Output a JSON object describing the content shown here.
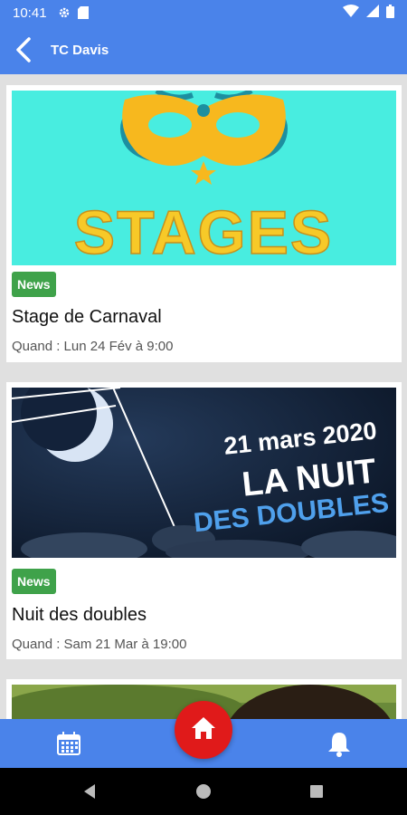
{
  "status_bar": {
    "time": "10:41",
    "icons": [
      "gear-icon",
      "sim-icon",
      "wifi-icon",
      "signal-icon",
      "battery-icon"
    ]
  },
  "app_bar": {
    "title": "TC Davis",
    "back_icon": "back-arrow-icon"
  },
  "feed": {
    "items": [
      {
        "badge": "News",
        "title": "Stage de Carnaval",
        "when": "Quand : Lun 24 Fév à 9:00",
        "image": {
          "text": "STAGES",
          "background": "#48ede0"
        }
      },
      {
        "badge": "News",
        "title": "Nuit des doubles",
        "when": "Quand : Sam 21 Mar à 19:00",
        "image": {
          "date": "21 mars 2020",
          "line1": "LA NUIT",
          "line2": "DES DOUBLES",
          "background": "#0e1a2e"
        }
      },
      {
        "image": {
          "background": "#6a8a3a"
        }
      }
    ]
  },
  "bottom_nav": {
    "items": [
      "calendar-icon",
      "home-icon",
      "bell-icon"
    ]
  },
  "colors": {
    "primary": "#4a83ea",
    "badge": "#3fa24a",
    "fab": "#e01a1a"
  }
}
